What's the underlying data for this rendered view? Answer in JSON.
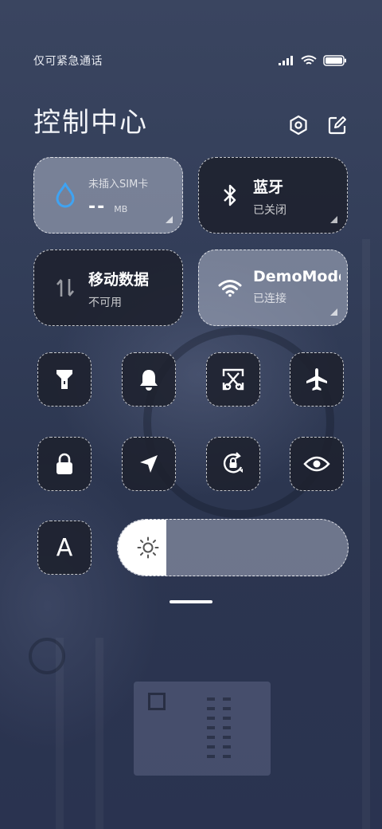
{
  "status_bar": {
    "carrier": "仅可紧急通话",
    "icons": [
      "signal-icon",
      "wifi-icon",
      "battery-icon"
    ]
  },
  "header": {
    "title": "控制中心",
    "actions": [
      "settings-icon",
      "edit-icon"
    ]
  },
  "tiles": {
    "sim": {
      "label": "未插入SIM卡",
      "value": "--",
      "unit": "MB",
      "icon": "water-drop-icon",
      "accent": "#3fa3f2"
    },
    "bluetooth": {
      "label": "蓝牙",
      "status": "已关闭",
      "icon": "bluetooth-icon"
    },
    "mobile_data": {
      "label": "移动数据",
      "status": "不可用",
      "icon": "data-arrows-icon"
    },
    "wifi": {
      "label": "DemoMode",
      "status": "已连接",
      "icon": "wifi-icon"
    }
  },
  "toggles": [
    {
      "name": "flashlight",
      "icon": "flashlight-icon"
    },
    {
      "name": "ringer",
      "icon": "bell-icon"
    },
    {
      "name": "screenshot",
      "icon": "scissors-icon"
    },
    {
      "name": "airplane-mode",
      "icon": "airplane-icon"
    },
    {
      "name": "lock-screen",
      "icon": "lock-icon"
    },
    {
      "name": "location",
      "icon": "location-arrow-icon"
    },
    {
      "name": "rotation-lock",
      "icon": "rotation-lock-icon"
    },
    {
      "name": "reading-mode",
      "icon": "eye-icon"
    }
  ],
  "auto_brightness": {
    "label": "A"
  },
  "brightness": {
    "level": 0.21,
    "icon": "sun-icon"
  }
}
